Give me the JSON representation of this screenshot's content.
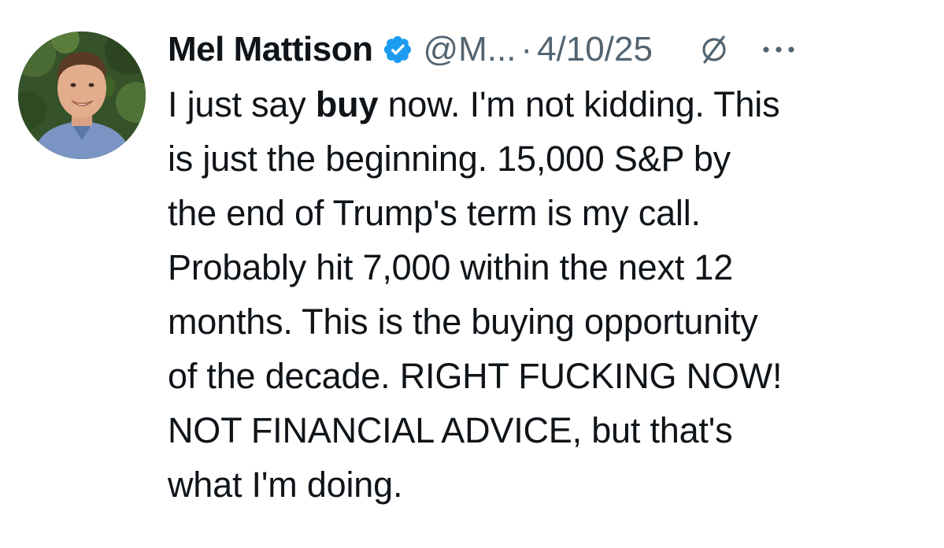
{
  "author": {
    "name": "Mel Mattison",
    "handle": "@M...",
    "separator": "·",
    "date": "4/10/25",
    "verified_icon": "verified-badge-icon",
    "avatar": "profile-photo"
  },
  "icons": {
    "grok": "grok-icon",
    "more": "more-options-icon"
  },
  "colors": {
    "verified_blue": "#1d9bf0",
    "text_primary": "#0f1419",
    "text_secondary": "#536471"
  },
  "tweet": {
    "line1_pre": "I just say ",
    "line1_bold": "buy",
    "line1_post": " now. I'm not kidding. This",
    "line2": "is just the beginning. 15,000 S&P by",
    "line3": "the end of Trump's term is my call.",
    "line4": "Probably hit 7,000 within the next 12",
    "line5": "months. This is the buying opportunity",
    "line6": "of the decade. RIGHT FUCKING NOW!",
    "line7": "NOT FINANCIAL ADVICE, but that's",
    "line8": "what I'm doing."
  }
}
